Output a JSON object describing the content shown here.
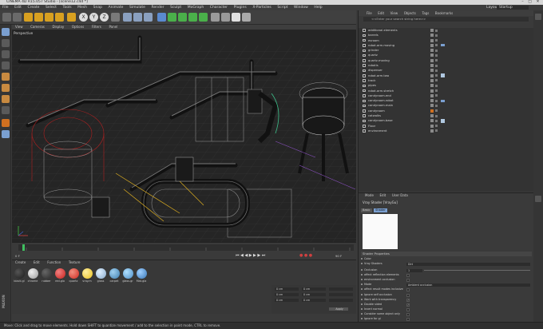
{
  "window": {
    "title": "CINEMA 4D R15.057 Studio - [scene12.c4d *]"
  },
  "menu": [
    "File",
    "Edit",
    "Create",
    "Select",
    "Tools",
    "Mesh",
    "Snap",
    "Animate",
    "Simulate",
    "Render",
    "Sculpt",
    "MoGraph",
    "Character",
    "Plugins",
    "X-Particles",
    "Script",
    "Window",
    "Help"
  ],
  "layout": {
    "label": "Layout:",
    "value": "Startup"
  },
  "viewport": {
    "menu": [
      "View",
      "Cameras",
      "Display",
      "Options",
      "Filters",
      "Panel"
    ],
    "label": "Perspective"
  },
  "objects": {
    "menu": [
      "File",
      "Edit",
      "View",
      "Objects",
      "Tags",
      "Bookmarks"
    ],
    "search_placeholder": "<<Enter your search string here>>",
    "items": [
      "additional.elements",
      "barrels",
      "esroom",
      "robot.arm.moving",
      "grinder",
      "quartz",
      "quartz.moving",
      "robotis",
      "dispenser",
      "robot.arm.two",
      "track",
      "pipes",
      "robot.arm.stretch",
      "candyroom.end",
      "candyroom.robot",
      "candyroom.main",
      "candyroom",
      "catwalks",
      "candyroom.base",
      "Floor",
      "environment"
    ]
  },
  "attributes": {
    "menu": [
      "Mode",
      "Edit",
      "User Data"
    ],
    "title": "Vray Shader [VrayGu]",
    "tabs": [
      "Basic",
      "Shader"
    ],
    "section": "Shader Properties",
    "props": [
      {
        "label": "Color",
        "value": ""
      },
      {
        "label": "Vray Shaders",
        "value": "Dirt"
      },
      {
        "label": "Occlusion",
        "value": "1"
      },
      {
        "label": "affect reflection elements",
        "value": ""
      },
      {
        "label": "environment occlusion",
        "value": ""
      },
      {
        "label": "Mode",
        "value": "Ambient occlusion"
      },
      {
        "label": "affect result modes inclusive",
        "value": ""
      },
      {
        "label": "Ignore self occlusion",
        "value": ""
      },
      {
        "label": "Work with transparency",
        "value": "✓"
      },
      {
        "label": "Double sided",
        "value": "✓"
      },
      {
        "label": "Invert normal",
        "value": ""
      },
      {
        "label": "Consider same object only",
        "value": ""
      },
      {
        "label": "Ignore for gi",
        "value": ""
      },
      {
        "label": "Radius",
        "value": ""
      },
      {
        "label": "Bias x",
        "value": ""
      }
    ]
  },
  "materials": {
    "menu": [
      "Create",
      "Edit",
      "Function",
      "Texture"
    ],
    "items": [
      {
        "label": "black.gl",
        "color": "#1c1c1c"
      },
      {
        "label": "chrome",
        "color": "#9a9a9a"
      },
      {
        "label": "rubber",
        "color": "#2a2a2a"
      },
      {
        "label": "red.glo",
        "color": "#c8201a"
      },
      {
        "label": "quartz",
        "color": "#d02a20"
      },
      {
        "label": "vray.m",
        "color": "#e8c020"
      },
      {
        "label": "glass",
        "color": "#88aacc"
      },
      {
        "label": "carpet",
        "color": "#3f7fb0"
      },
      {
        "label": "glass.gr",
        "color": "#4c8cc4"
      },
      {
        "label": "Mat.gla",
        "color": "#3a78b8"
      }
    ]
  },
  "timeline": {
    "start": "0 F",
    "end": "90 F"
  },
  "coords": {
    "apply": "Apply",
    "x": "0 cm",
    "y": "0 cm",
    "z": "0 cm"
  },
  "status": {
    "text": "Move: Click and drag to move elements. Hold down SHIFT to quantize movement / add to the selection in point mode, CTRL to remove."
  },
  "colors": {
    "accent": "#7a9fd0",
    "bg": "#3a3a3a",
    "viewport": "#262626"
  }
}
